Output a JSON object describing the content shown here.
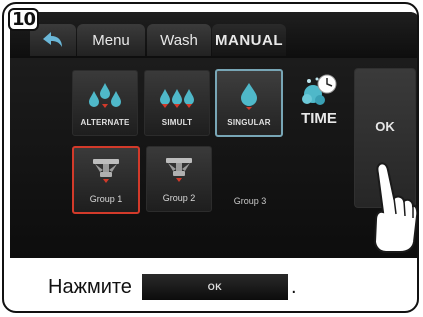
{
  "step_badge": "10",
  "tabs": {
    "back_icon": "back-arrow-icon",
    "menu": "Menu",
    "wash": "Wash",
    "manual": "MANUAL"
  },
  "modes": [
    {
      "label": "ALTERNATE",
      "icon": "droplets-alternate-icon"
    },
    {
      "label": "SIMULT",
      "icon": "droplets-simult-icon"
    },
    {
      "label": "SINGULAR",
      "icon": "droplet-singular-icon",
      "selected": true
    }
  ],
  "time_tile": {
    "label": "TIME",
    "icon": "clock-bubbles-icon"
  },
  "groups": [
    {
      "label": "Group 1",
      "selected": true
    },
    {
      "label": "Group 2"
    },
    {
      "label": "Group 3"
    }
  ],
  "ok_button": {
    "label": "OK"
  },
  "instruction": {
    "text": "Нажмите",
    "button_label": "OK",
    "trailing": "."
  },
  "colors": {
    "accent_drop": "#4fb8c9",
    "selected_red": "#d23a2a",
    "selected_blue": "#78a6b6"
  }
}
